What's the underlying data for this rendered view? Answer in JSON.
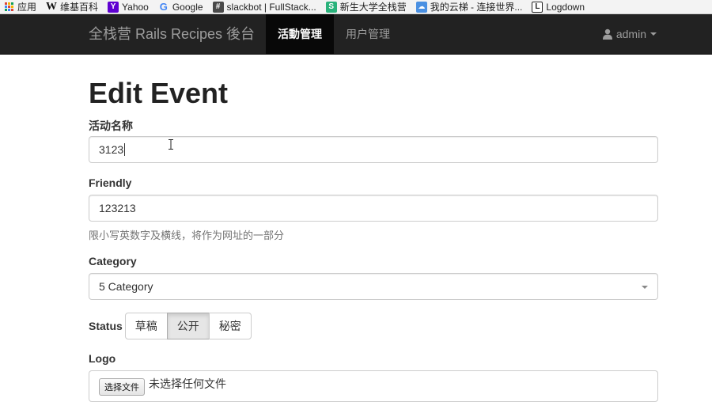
{
  "bookmarks": [
    {
      "icon": "apps-grid-icon",
      "label": "应用"
    },
    {
      "icon": "wikipedia-icon",
      "label": "维基百科"
    },
    {
      "icon": "yahoo-icon",
      "label": "Yahoo"
    },
    {
      "icon": "google-icon",
      "label": "Google"
    },
    {
      "icon": "hash-icon",
      "label": "slackbot | FullStack..."
    },
    {
      "icon": "school-icon",
      "label": "新生大学全栈营"
    },
    {
      "icon": "cloud-icon",
      "label": "我的云梯 - 连接世界..."
    },
    {
      "icon": "logdown-icon",
      "label": "Logdown"
    }
  ],
  "navbar": {
    "brand": "全栈营 Rails Recipes 後台",
    "items": [
      {
        "label": "活動管理",
        "active": true
      },
      {
        "label": "用户管理",
        "active": false
      }
    ],
    "user": "admin"
  },
  "page": {
    "title": "Edit Event",
    "fields": {
      "name_label": "活动名称",
      "name_value": "3123",
      "friendly_label": "Friendly",
      "friendly_value": "123213",
      "friendly_help": "限小写英数字及横线，将作为网址的一部分",
      "category_label": "Category",
      "category_value": "5 Category",
      "status_label": "Status",
      "status_options": [
        "草稿",
        "公开",
        "秘密"
      ],
      "status_selected": "公开",
      "logo_label": "Logo",
      "file_button": "选择文件",
      "file_status": "未选择任何文件"
    }
  },
  "colors": {
    "navbar_bg": "#222222",
    "navbar_active_bg": "#080808",
    "navbar_text": "#9d9d9d"
  }
}
